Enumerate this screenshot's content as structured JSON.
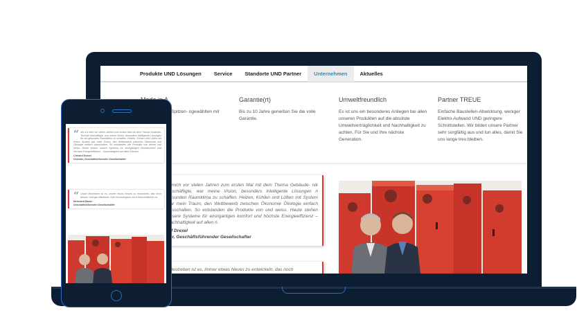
{
  "nav": {
    "items": [
      {
        "label": "Produkte UND Lösungen"
      },
      {
        "label": "Service"
      },
      {
        "label": "Standorte UND Partner"
      },
      {
        "label": "Unternehmen"
      },
      {
        "label": "Aktuelles"
      }
    ],
    "active_index": 3
  },
  "features": [
    {
      "title": "Made in A",
      "text": "sterreichischer Spitzen- ngewählten mit gehen Sie auf r."
    },
    {
      "title": "Garantie(rt)",
      "text": "Bis zu 10 Jahre genießen Sie die volle Garantie."
    },
    {
      "title": "Umweltfreundlich",
      "text": "Es ist uns ein besonderes Anliegen bei allen unseren Produkten auf die absolute Umweltverträglichkeit und Nachhaltigkeit zu achten. Für Sie und Ihre nächste Generation."
    },
    {
      "title": "Partner TREUE",
      "text": "Einfache Baustellen-Abwicklung, weniger Elektro-Aufwand UND geringere Schnittstellen. Wir bilden unsere Partner sehr sorgfältig aus und tun alles, damit Sie uns lange treu bleiben."
    }
  ],
  "laptop_testimonials": [
    {
      "text": "h mich vor vielen Jahren zum ersten Mal mit dem Thema Gebäude- nik beschäftigte, war meine Vision, besonders intelligente Lösungen n gesunden Raumklima zu schaffen. Heizen, Kühlen und Lüften mit System war mein Traum, den Wettbewerb zwischen Ökonomie Ökologie einfach ausschalten. So entstanden die Produkte von und weiss. Heute stehen unsere Systeme für einzigartigen komfort und höchste Energieeffizienz – Nachhaltigkeit auf allen n.",
      "author_line1": "tof Drexel",
      "author_line2": "der, Geschäftsführender Gesellschafter"
    },
    {
      "text": "r Bestreben ist es, immer etwas Neues zu entwickeln, das noch"
    }
  ],
  "mobile_testimonials": [
    {
      "text": "Als ich mich vor vielen Jahren zum ersten Mal mit dem Thema Gebäude-Technik beschäftigte, war meine Vision, besonders intelligente Lösungen für ein gesundes Raumklima zu schaffen. Heizen, Kühlen und Lüften mit einem System war mein Traum, den Wettbewerb zwischen Ökonomie und Ökologie einfach ausschalten. So entstanden die Produkte von drexel und weiss. Heute stehen unsere Systeme für einzigartigen Wohnkomfort und höchste Energieeffizienz – Nachhaltigkeit auf allen Ebenen.",
      "author_line1": "Christof Drexel",
      "author_line2": "Gründer, Geschäftsführender Gesellschafter"
    },
    {
      "text": "Unser Bestreben ist es, immer etwas Neues zu entwickeln, das noch besser, energie-effizienter UND technologisch noch fortschrittlicher ist.",
      "author_line1": "Bernhard Bauer",
      "author_line2": "Geschäftsführender Gesellschafter"
    }
  ],
  "colors": {
    "frame": "#0d1e33",
    "outline": "#2c6fc0",
    "accent_red": "#d63a34",
    "nav_active_text": "#3d8aa8"
  }
}
